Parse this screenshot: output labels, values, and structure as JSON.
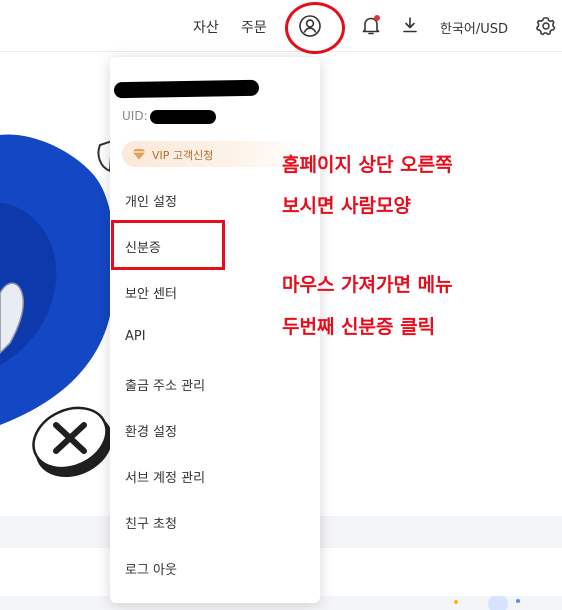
{
  "topbar": {
    "assets_label": "자산",
    "orders_label": "주문",
    "language_label": "한국어/USD"
  },
  "dropdown": {
    "uid_label": "UID:",
    "vip_label": "VIP 고객신청",
    "items": [
      {
        "label": "개인 설정"
      },
      {
        "label": "신분증"
      },
      {
        "label": "보안 센터"
      },
      {
        "label": "API"
      },
      {
        "label": "출금 주소 관리"
      },
      {
        "label": "환경 설정"
      },
      {
        "label": "서브 계정 관리"
      },
      {
        "label": "친구 초청"
      },
      {
        "label": "로그 아웃"
      }
    ]
  },
  "annotations": {
    "line1": "홈페이지 상단 오른쪽",
    "line2": "보시면 사람모양",
    "line3": "마우스 가져가면 메뉴",
    "line4": "두번째 신분증 클릭"
  },
  "colors": {
    "annotation_red": "#e60d1c",
    "hero_blue": "#1447c4",
    "vip_text": "#b06f2e"
  }
}
